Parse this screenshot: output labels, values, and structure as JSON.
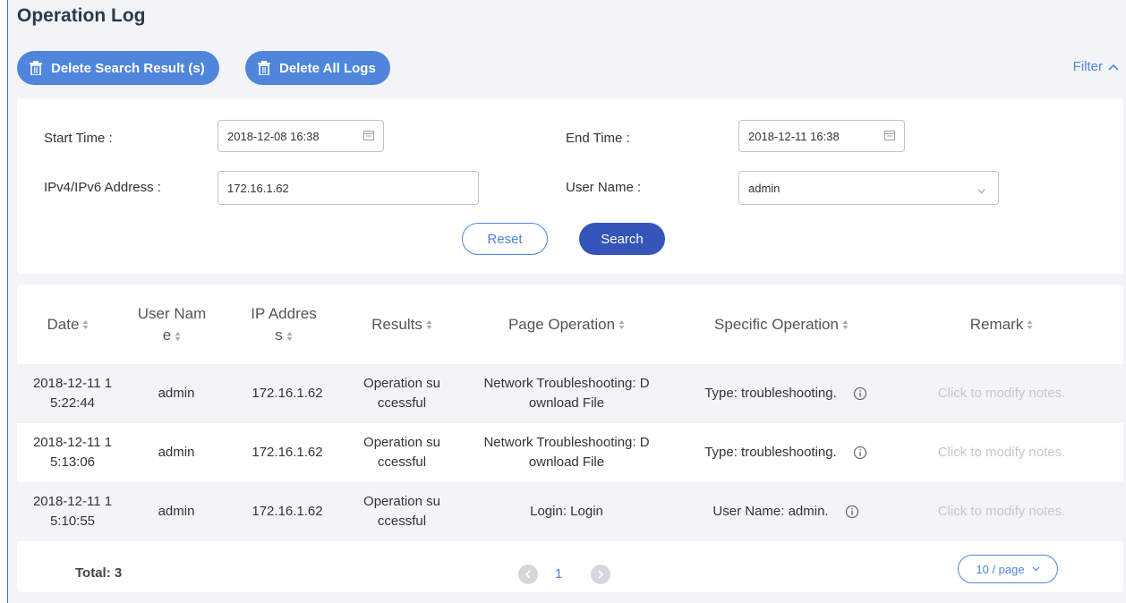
{
  "page": {
    "title": "Operation Log"
  },
  "toolbar": {
    "delete_search_label": "Delete Search Result (s)",
    "delete_all_label": "Delete All Logs",
    "filter_label": "Filter"
  },
  "filter": {
    "start_time_label": "Start Time :",
    "start_time_value": "2018-12-08 16:38",
    "end_time_label": "End Time :",
    "end_time_value": "2018-12-11 16:38",
    "ip_label": "IPv4/IPv6 Address :",
    "ip_value": "172.16.1.62",
    "user_label": "User Name :",
    "user_value": "admin",
    "reset_label": "Reset",
    "search_label": "Search"
  },
  "table": {
    "headers": {
      "date": "Date",
      "user_name_1": "User Nam",
      "user_name_2": "e",
      "ip_1": "IP Addres",
      "ip_2": "s",
      "results": "Results",
      "page_operation": "Page Operation",
      "specific_operation": "Specific Operation",
      "remark": "Remark"
    },
    "rows": [
      {
        "date_1": "2018-12-11 1",
        "date_2": "5:22:44",
        "user": "admin",
        "ip": "172.16.1.62",
        "result_1": "Operation su",
        "result_2": "ccessful",
        "page_op_1": "Network Troubleshooting: D",
        "page_op_2": "ownload File",
        "specific_op": "Type: troubleshooting.",
        "remark": "Click to modify notes."
      },
      {
        "date_1": "2018-12-11 1",
        "date_2": "5:13:06",
        "user": "admin",
        "ip": "172.16.1.62",
        "result_1": "Operation su",
        "result_2": "ccessful",
        "page_op_1": "Network Troubleshooting: D",
        "page_op_2": "ownload File",
        "specific_op": "Type: troubleshooting.",
        "remark": "Click to modify notes."
      },
      {
        "date_1": "2018-12-11 1",
        "date_2": "5:10:55",
        "user": "admin",
        "ip": "172.16.1.62",
        "result_1": "Operation su",
        "result_2": "ccessful",
        "page_op_1": "Login: Login",
        "page_op_2": "",
        "specific_op": "User Name: admin.",
        "remark": "Click to modify notes."
      }
    ]
  },
  "footer": {
    "total": "Total: 3",
    "current_page": "1",
    "page_size": "10 / page"
  },
  "icons": {
    "trash": "trash-icon",
    "chevron_up": "chevron-up-icon",
    "calendar": "calendar-icon",
    "chevron_down": "chevron-down-icon",
    "sort": "sort-icon",
    "info": "info-icon",
    "prev": "chevron-left-icon",
    "next": "chevron-right-icon"
  },
  "colors": {
    "primary": "#4f86dc",
    "primary_dark": "#3555b8",
    "background": "#f3f4f8",
    "muted_text": "#c4c7cc"
  }
}
